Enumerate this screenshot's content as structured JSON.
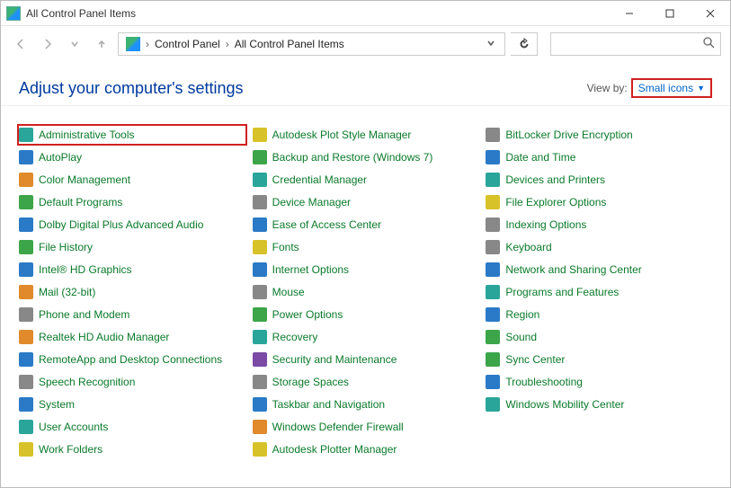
{
  "window": {
    "title": "All Control Panel Items"
  },
  "breadcrumb": {
    "root": "Control Panel",
    "current": "All Control Panel Items"
  },
  "header": {
    "title": "Adjust your computer's settings",
    "view_by_label": "View by:",
    "view_by_value": "Small icons"
  },
  "items": [
    {
      "name": "Administrative Tools",
      "icon": "ic-teal",
      "highlight": true
    },
    {
      "name": "AutoPlay",
      "icon": "ic-blue"
    },
    {
      "name": "Color Management",
      "icon": "ic-orange"
    },
    {
      "name": "Default Programs",
      "icon": "ic-green"
    },
    {
      "name": "Dolby Digital Plus Advanced Audio",
      "icon": "ic-blue"
    },
    {
      "name": "File History",
      "icon": "ic-green"
    },
    {
      "name": "Intel® HD Graphics",
      "icon": "ic-blue"
    },
    {
      "name": "Mail (32-bit)",
      "icon": "ic-orange"
    },
    {
      "name": "Phone and Modem",
      "icon": "ic-gray"
    },
    {
      "name": "Realtek HD Audio Manager",
      "icon": "ic-orange"
    },
    {
      "name": "RemoteApp and Desktop Connections",
      "icon": "ic-blue"
    },
    {
      "name": "Speech Recognition",
      "icon": "ic-gray"
    },
    {
      "name": "System",
      "icon": "ic-blue"
    },
    {
      "name": "User Accounts",
      "icon": "ic-teal"
    },
    {
      "name": "Work Folders",
      "icon": "ic-yellow"
    },
    {
      "name": "Autodesk Plot Style Manager",
      "icon": "ic-yellow"
    },
    {
      "name": "Backup and Restore (Windows 7)",
      "icon": "ic-green"
    },
    {
      "name": "Credential Manager",
      "icon": "ic-teal"
    },
    {
      "name": "Device Manager",
      "icon": "ic-gray"
    },
    {
      "name": "Ease of Access Center",
      "icon": "ic-blue"
    },
    {
      "name": "Fonts",
      "icon": "ic-yellow"
    },
    {
      "name": "Internet Options",
      "icon": "ic-blue"
    },
    {
      "name": "Mouse",
      "icon": "ic-gray"
    },
    {
      "name": "Power Options",
      "icon": "ic-green"
    },
    {
      "name": "Recovery",
      "icon": "ic-teal"
    },
    {
      "name": "Security and Maintenance",
      "icon": "ic-purple"
    },
    {
      "name": "Storage Spaces",
      "icon": "ic-gray"
    },
    {
      "name": "Taskbar and Navigation",
      "icon": "ic-blue"
    },
    {
      "name": "Windows Defender Firewall",
      "icon": "ic-orange"
    },
    {
      "name": "Autodesk Plotter Manager",
      "icon": "ic-yellow"
    },
    {
      "name": "BitLocker Drive Encryption",
      "icon": "ic-gray"
    },
    {
      "name": "Date and Time",
      "icon": "ic-blue"
    },
    {
      "name": "Devices and Printers",
      "icon": "ic-teal"
    },
    {
      "name": "File Explorer Options",
      "icon": "ic-yellow"
    },
    {
      "name": "Indexing Options",
      "icon": "ic-gray"
    },
    {
      "name": "Keyboard",
      "icon": "ic-gray"
    },
    {
      "name": "Network and Sharing Center",
      "icon": "ic-blue"
    },
    {
      "name": "Programs and Features",
      "icon": "ic-teal"
    },
    {
      "name": "Region",
      "icon": "ic-blue"
    },
    {
      "name": "Sound",
      "icon": "ic-green"
    },
    {
      "name": "Sync Center",
      "icon": "ic-green"
    },
    {
      "name": "Troubleshooting",
      "icon": "ic-blue"
    },
    {
      "name": "Windows Mobility Center",
      "icon": "ic-teal"
    }
  ]
}
